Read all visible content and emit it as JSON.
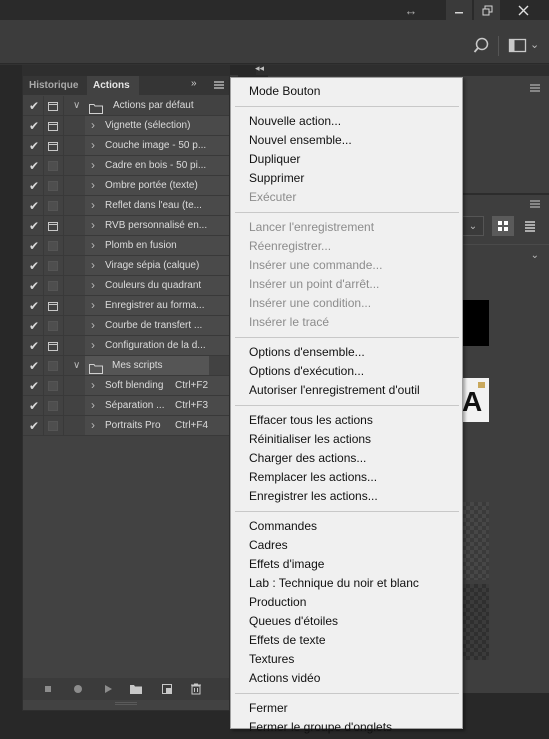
{
  "window": {
    "resize_icon": "resize-arrows-icon",
    "minimize_icon": "minimize-icon",
    "maximize_icon": "restore-icon",
    "close_icon": "close-icon"
  },
  "optionsbar": {
    "search_icon": "search-icon",
    "workspace_icon": "workspace-icon"
  },
  "panel": {
    "tabs": [
      {
        "label": "Historique",
        "active": false
      },
      {
        "label": "Actions",
        "active": true
      }
    ],
    "collapse_glyph": "»",
    "rows": [
      {
        "label": "Actions par défaut",
        "type": "set",
        "expanded": true,
        "checked": true,
        "dialog": true,
        "shortcut": ""
      },
      {
        "label": "Vignette (sélection)",
        "type": "action",
        "checked": true,
        "dialog": true,
        "shortcut": ""
      },
      {
        "label": "Couche image - 50 p...",
        "type": "action",
        "checked": true,
        "dialog": true,
        "shortcut": ""
      },
      {
        "label": "Cadre en bois - 50 pi...",
        "type": "action",
        "checked": true,
        "dialog": false,
        "shortcut": ""
      },
      {
        "label": "Ombre portée (texte)",
        "type": "action",
        "checked": true,
        "dialog": false,
        "shortcut": ""
      },
      {
        "label": "Reflet dans l'eau (te...",
        "type": "action",
        "checked": true,
        "dialog": false,
        "shortcut": ""
      },
      {
        "label": "RVB personnalisé en...",
        "type": "action",
        "checked": true,
        "dialog": true,
        "shortcut": ""
      },
      {
        "label": "Plomb en fusion",
        "type": "action",
        "checked": true,
        "dialog": false,
        "shortcut": ""
      },
      {
        "label": "Virage sépia (calque)",
        "type": "action",
        "checked": true,
        "dialog": false,
        "shortcut": ""
      },
      {
        "label": "Couleurs du quadrant",
        "type": "action",
        "checked": true,
        "dialog": false,
        "shortcut": ""
      },
      {
        "label": "Enregistrer au forma...",
        "type": "action",
        "checked": true,
        "dialog": true,
        "shortcut": ""
      },
      {
        "label": "Courbe de transfert ...",
        "type": "action",
        "checked": true,
        "dialog": false,
        "shortcut": ""
      },
      {
        "label": "Configuration de la d...",
        "type": "action",
        "checked": true,
        "dialog": true,
        "shortcut": ""
      },
      {
        "label": "Mes scripts",
        "type": "set",
        "expanded": true,
        "checked": true,
        "dialog": false,
        "shortcut": ""
      },
      {
        "label": "Soft blending",
        "type": "action",
        "checked": true,
        "dialog": false,
        "shortcut": "Ctrl+F2"
      },
      {
        "label": "Séparation ...",
        "type": "action",
        "checked": true,
        "dialog": false,
        "shortcut": "Ctrl+F3"
      },
      {
        "label": "Portraits Pro",
        "type": "action",
        "checked": true,
        "dialog": false,
        "shortcut": "Ctrl+F4"
      }
    ],
    "tools": [
      "stop-icon",
      "record-icon",
      "play-icon",
      "new-set-icon",
      "new-action-icon",
      "trash-icon"
    ]
  },
  "menu": {
    "groups": [
      [
        {
          "label": "Mode Bouton",
          "enabled": true
        }
      ],
      [
        {
          "label": "Nouvelle action...",
          "enabled": true
        },
        {
          "label": "Nouvel ensemble...",
          "enabled": true
        },
        {
          "label": "Dupliquer",
          "enabled": true
        },
        {
          "label": "Supprimer",
          "enabled": true
        },
        {
          "label": "Exécuter",
          "enabled": false
        }
      ],
      [
        {
          "label": "Lancer l'enregistrement",
          "enabled": false
        },
        {
          "label": "Réenregistrer...",
          "enabled": false
        },
        {
          "label": "Insérer une commande...",
          "enabled": false
        },
        {
          "label": "Insérer un point d'arrêt...",
          "enabled": false
        },
        {
          "label": "Insérer une condition...",
          "enabled": false
        },
        {
          "label": "Insérer le tracé",
          "enabled": false
        }
      ],
      [
        {
          "label": "Options d'ensemble...",
          "enabled": true
        },
        {
          "label": "Options d'exécution...",
          "enabled": true
        },
        {
          "label": "Autoriser l'enregistrement d'outil",
          "enabled": true
        }
      ],
      [
        {
          "label": "Effacer tous les actions",
          "enabled": true
        },
        {
          "label": "Réinitialiser les actions",
          "enabled": true
        },
        {
          "label": "Charger des actions...",
          "enabled": true
        },
        {
          "label": "Remplacer les actions...",
          "enabled": true
        },
        {
          "label": "Enregistrer les actions...",
          "enabled": true
        }
      ],
      [
        {
          "label": "Commandes",
          "enabled": true
        },
        {
          "label": "Cadres",
          "enabled": true
        },
        {
          "label": "Effets d'image",
          "enabled": true
        },
        {
          "label": "Lab : Technique du noir et blanc",
          "enabled": true
        },
        {
          "label": "Production",
          "enabled": true
        },
        {
          "label": "Queues d'étoiles",
          "enabled": true
        },
        {
          "label": "Effets de texte",
          "enabled": true
        },
        {
          "label": "Textures",
          "enabled": true
        },
        {
          "label": "Actions vidéo",
          "enabled": true
        }
      ],
      [
        {
          "label": "Fermer",
          "enabled": true
        },
        {
          "label": "Fermer le groupe d'onglets",
          "enabled": true
        }
      ]
    ]
  },
  "thumbnails": {
    "letter": "A"
  },
  "colors": {
    "panel_bg": "#424242",
    "menu_bg": "#f0f0f0",
    "menu_disabled": "#8c8c8c"
  }
}
